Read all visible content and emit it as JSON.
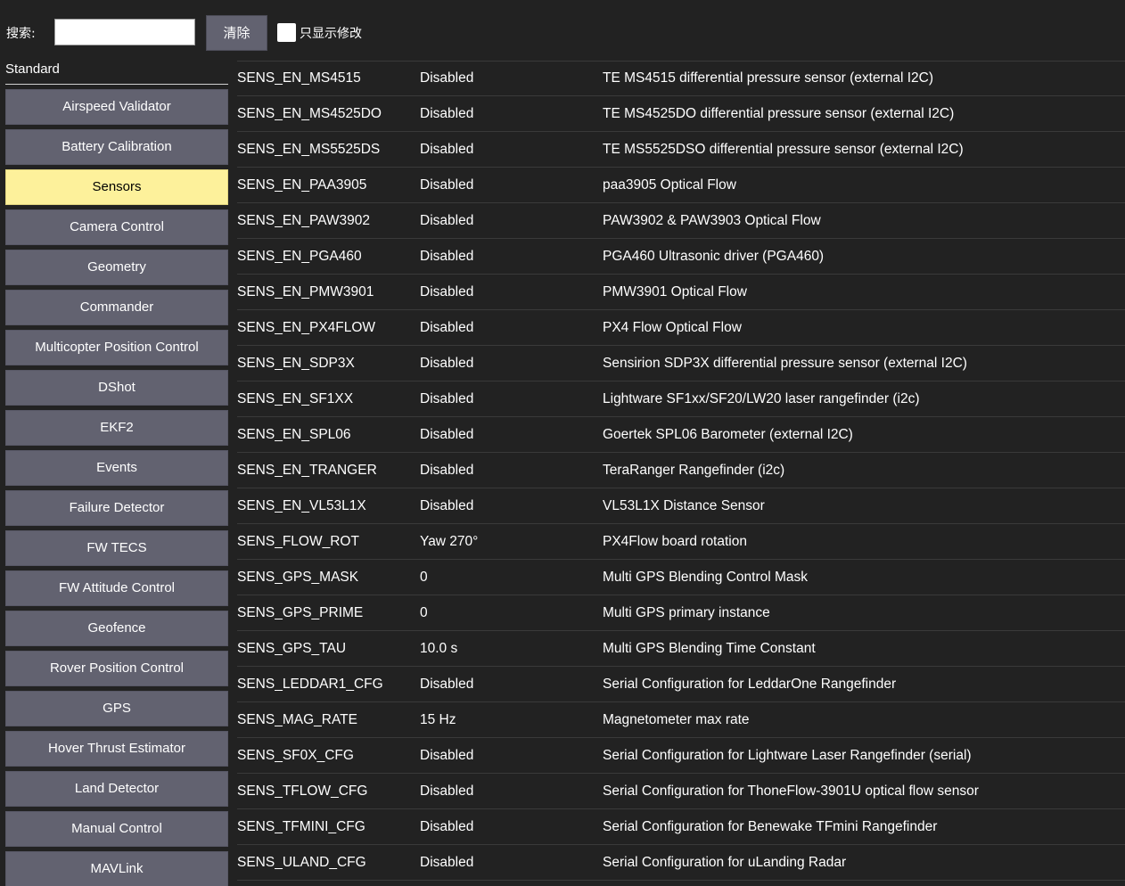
{
  "toolbar": {
    "search_label": "搜索:",
    "search_value": "",
    "clear_label": "清除",
    "modified_only_label": "只显示修改",
    "modified_only_checked": false
  },
  "sidebar": {
    "group_title": "Standard",
    "items": [
      {
        "label": "Airspeed Validator",
        "selected": false
      },
      {
        "label": "Battery Calibration",
        "selected": false
      },
      {
        "label": "Sensors",
        "selected": true
      },
      {
        "label": "Camera Control",
        "selected": false
      },
      {
        "label": "Geometry",
        "selected": false
      },
      {
        "label": "Commander",
        "selected": false
      },
      {
        "label": "Multicopter Position Control",
        "selected": false
      },
      {
        "label": "DShot",
        "selected": false
      },
      {
        "label": "EKF2",
        "selected": false
      },
      {
        "label": "Events",
        "selected": false
      },
      {
        "label": "Failure Detector",
        "selected": false
      },
      {
        "label": "FW TECS",
        "selected": false
      },
      {
        "label": "FW Attitude Control",
        "selected": false
      },
      {
        "label": "Geofence",
        "selected": false
      },
      {
        "label": "Rover Position Control",
        "selected": false
      },
      {
        "label": "GPS",
        "selected": false
      },
      {
        "label": "Hover Thrust Estimator",
        "selected": false
      },
      {
        "label": "Land Detector",
        "selected": false
      },
      {
        "label": "Manual Control",
        "selected": false
      },
      {
        "label": "MAVLink",
        "selected": false
      }
    ]
  },
  "params": [
    {
      "name": "SENS_EN_MS4515",
      "value": "Disabled",
      "description": "TE MS4515 differential pressure sensor (external I2C)"
    },
    {
      "name": "SENS_EN_MS4525DO",
      "value": "Disabled",
      "description": "TE MS4525DO differential pressure sensor (external I2C)"
    },
    {
      "name": "SENS_EN_MS5525DS",
      "value": "Disabled",
      "description": "TE MS5525DSO differential pressure sensor (external I2C)"
    },
    {
      "name": "SENS_EN_PAA3905",
      "value": "Disabled",
      "description": "paa3905 Optical Flow"
    },
    {
      "name": "SENS_EN_PAW3902",
      "value": "Disabled",
      "description": "PAW3902 & PAW3903 Optical Flow"
    },
    {
      "name": "SENS_EN_PGA460",
      "value": "Disabled",
      "description": "PGA460 Ultrasonic driver (PGA460)"
    },
    {
      "name": "SENS_EN_PMW3901",
      "value": "Disabled",
      "description": "PMW3901 Optical Flow"
    },
    {
      "name": "SENS_EN_PX4FLOW",
      "value": "Disabled",
      "description": "PX4 Flow Optical Flow"
    },
    {
      "name": "SENS_EN_SDP3X",
      "value": "Disabled",
      "description": "Sensirion SDP3X differential pressure sensor (external I2C)"
    },
    {
      "name": "SENS_EN_SF1XX",
      "value": "Disabled",
      "description": "Lightware SF1xx/SF20/LW20 laser rangefinder (i2c)"
    },
    {
      "name": "SENS_EN_SPL06",
      "value": "Disabled",
      "description": "Goertek SPL06 Barometer (external I2C)"
    },
    {
      "name": "SENS_EN_TRANGER",
      "value": "Disabled",
      "description": "TeraRanger Rangefinder (i2c)"
    },
    {
      "name": "SENS_EN_VL53L1X",
      "value": "Disabled",
      "description": "VL53L1X Distance Sensor"
    },
    {
      "name": "SENS_FLOW_ROT",
      "value": "Yaw 270°",
      "description": "PX4Flow board rotation"
    },
    {
      "name": "SENS_GPS_MASK",
      "value": "0",
      "description": "Multi GPS Blending Control Mask"
    },
    {
      "name": "SENS_GPS_PRIME",
      "value": "0",
      "description": "Multi GPS primary instance"
    },
    {
      "name": "SENS_GPS_TAU",
      "value": "10.0 s",
      "description": "Multi GPS Blending Time Constant"
    },
    {
      "name": "SENS_LEDDAR1_CFG",
      "value": "Disabled",
      "description": "Serial Configuration for LeddarOne Rangefinder"
    },
    {
      "name": "SENS_MAG_RATE",
      "value": "15 Hz",
      "description": "Magnetometer max rate"
    },
    {
      "name": "SENS_SF0X_CFG",
      "value": "Disabled",
      "description": "Serial Configuration for Lightware Laser Rangefinder (serial)"
    },
    {
      "name": "SENS_TFLOW_CFG",
      "value": "Disabled",
      "description": "Serial Configuration for ThoneFlow-3901U optical flow sensor"
    },
    {
      "name": "SENS_TFMINI_CFG",
      "value": "Disabled",
      "description": "Serial Configuration for Benewake TFmini Rangefinder"
    },
    {
      "name": "SENS_ULAND_CFG",
      "value": "Disabled",
      "description": "Serial Configuration for uLanding Radar"
    }
  ]
}
